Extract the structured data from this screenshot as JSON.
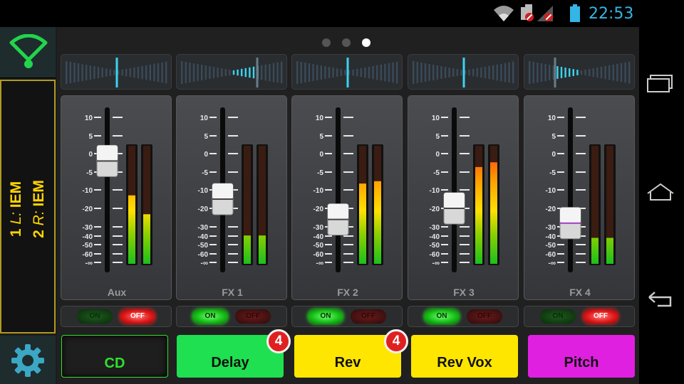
{
  "status_bar": {
    "time": "22:53",
    "icons": [
      "wifi-icon",
      "sd-card-blocked-icon",
      "signal-blocked-icon",
      "battery-icon"
    ]
  },
  "sidebar": {
    "wifi_icon": "wifi-icon",
    "mix_lines": [
      {
        "num": "1",
        "label": "L:",
        "value": "IEM"
      },
      {
        "num": "2",
        "label": "R:",
        "value": "IEM"
      }
    ],
    "settings_icon": "gear-icon",
    "accent": "#ffd400"
  },
  "pager": {
    "count": 3,
    "active": 2
  },
  "scale_labels": [
    "10",
    "5",
    "0",
    "-5",
    "-10",
    "-20",
    "-30",
    "-40",
    "-50",
    "-60",
    "-∞"
  ],
  "channels": [
    {
      "name": "Aux",
      "pan": 0.0,
      "fader_db": -2,
      "meter_level": [
        0.58,
        0.42
      ],
      "on": false
    },
    {
      "name": "FX 1",
      "pan": 0.25,
      "fader_db": -15,
      "meter_level": [
        0.24,
        0.24
      ],
      "on": true
    },
    {
      "name": "FX 2",
      "pan": 0.0,
      "fader_db": -26,
      "meter_level": [
        0.68,
        0.7
      ],
      "on": true
    },
    {
      "name": "FX 3",
      "pan": 0.0,
      "fader_db": -20,
      "meter_level": [
        0.82,
        0.86
      ],
      "on": true
    },
    {
      "name": "FX 4",
      "pan": -0.25,
      "fader_db": -28,
      "meter_level": [
        0.22,
        0.22
      ],
      "on": false
    }
  ],
  "toggle_labels": {
    "on": "ON",
    "off": "OFF"
  },
  "fx_buttons": [
    {
      "label": "CD",
      "bg": "#1e1e1e",
      "text_color": "#2ee02e",
      "badge": ""
    },
    {
      "label": "Delay",
      "bg": "#1ee050",
      "text_color": "#111111",
      "badge": "4"
    },
    {
      "label": "Rev",
      "bg": "#ffe600",
      "text_color": "#111111",
      "badge": "4"
    },
    {
      "label": "Rev Vox",
      "bg": "#ffe600",
      "text_color": "#111111",
      "badge": ""
    },
    {
      "label": "Pitch",
      "bg": "#e020e0",
      "text_color": "#111111",
      "badge": ""
    }
  ],
  "nav_icons": [
    "recent-apps-icon",
    "home-icon",
    "back-icon"
  ]
}
